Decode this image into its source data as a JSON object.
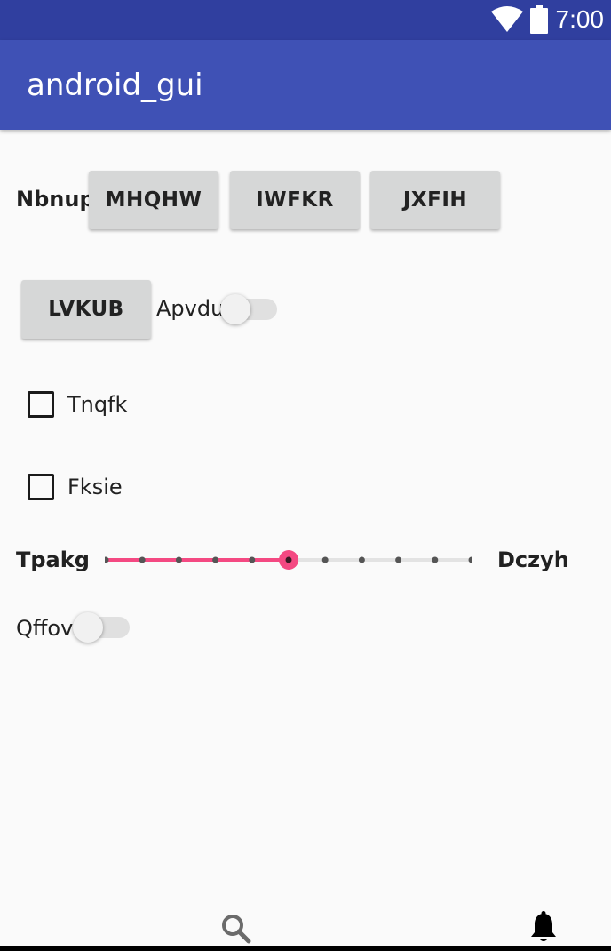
{
  "status_bar": {
    "time": "7:00",
    "icons": [
      "wifi-icon",
      "battery-icon"
    ],
    "color": "#303f9f"
  },
  "app_bar": {
    "title": "android_gui",
    "color": "#3f51b5"
  },
  "row1": {
    "label": "Nbnup",
    "buttons": [
      "MHQHW",
      "IWFKR",
      "JXFIH"
    ]
  },
  "row2": {
    "button": "LVKUB",
    "switch_label": "Apvdu",
    "switch_on": false
  },
  "checkboxes": [
    {
      "label": "Tnqfk",
      "checked": false
    },
    {
      "label": "Fksie",
      "checked": false
    }
  ],
  "slider": {
    "left_label": "Tpakg",
    "right_label": "Dczyh",
    "steps": 10,
    "value": 5,
    "accent_color": "#f44982"
  },
  "switch2": {
    "label": "Qffov",
    "on": false
  },
  "bottom_bar": {
    "icons": [
      "search-icon",
      "bell-icon"
    ]
  }
}
